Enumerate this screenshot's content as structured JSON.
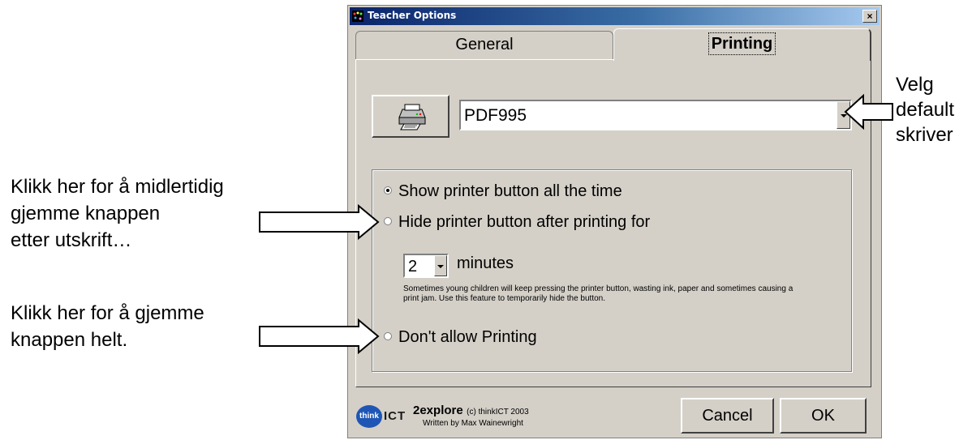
{
  "window": {
    "title": "Teacher Options",
    "close_glyph": "×"
  },
  "tabs": [
    {
      "label": "General",
      "active": false
    },
    {
      "label": "Printing",
      "active": true
    }
  ],
  "printer": {
    "selected": "PDF995",
    "button_icon": "printer-icon"
  },
  "options": {
    "radio1": {
      "label": "Show printer button all the time",
      "checked": true
    },
    "radio2": {
      "label": "Hide printer button after printing for",
      "checked": false
    },
    "minutes_value": "2",
    "minutes_label": "minutes",
    "help_text": "Sometimes young children will keep pressing the printer button, wasting ink, paper and sometimes causing a print jam. Use this feature to temporarily hide the button.",
    "radio3": {
      "label": "Don't allow Printing",
      "checked": false
    }
  },
  "footer": {
    "logo_think": "think",
    "logo_ict": "ICT",
    "product_name": "2explore",
    "product_copyright": "(c) thinkICT 2003",
    "author": "Written by Max Wainewright",
    "cancel_label": "Cancel",
    "ok_label": "OK"
  },
  "annotations": {
    "right": [
      "Velg",
      "default",
      "skriver"
    ],
    "left1": [
      "Klikk her for å midlertidig",
      "gjemme knappen",
      "etter utskrift…"
    ],
    "left2": [
      "Klikk her for å gjemme",
      "knappen helt."
    ]
  }
}
